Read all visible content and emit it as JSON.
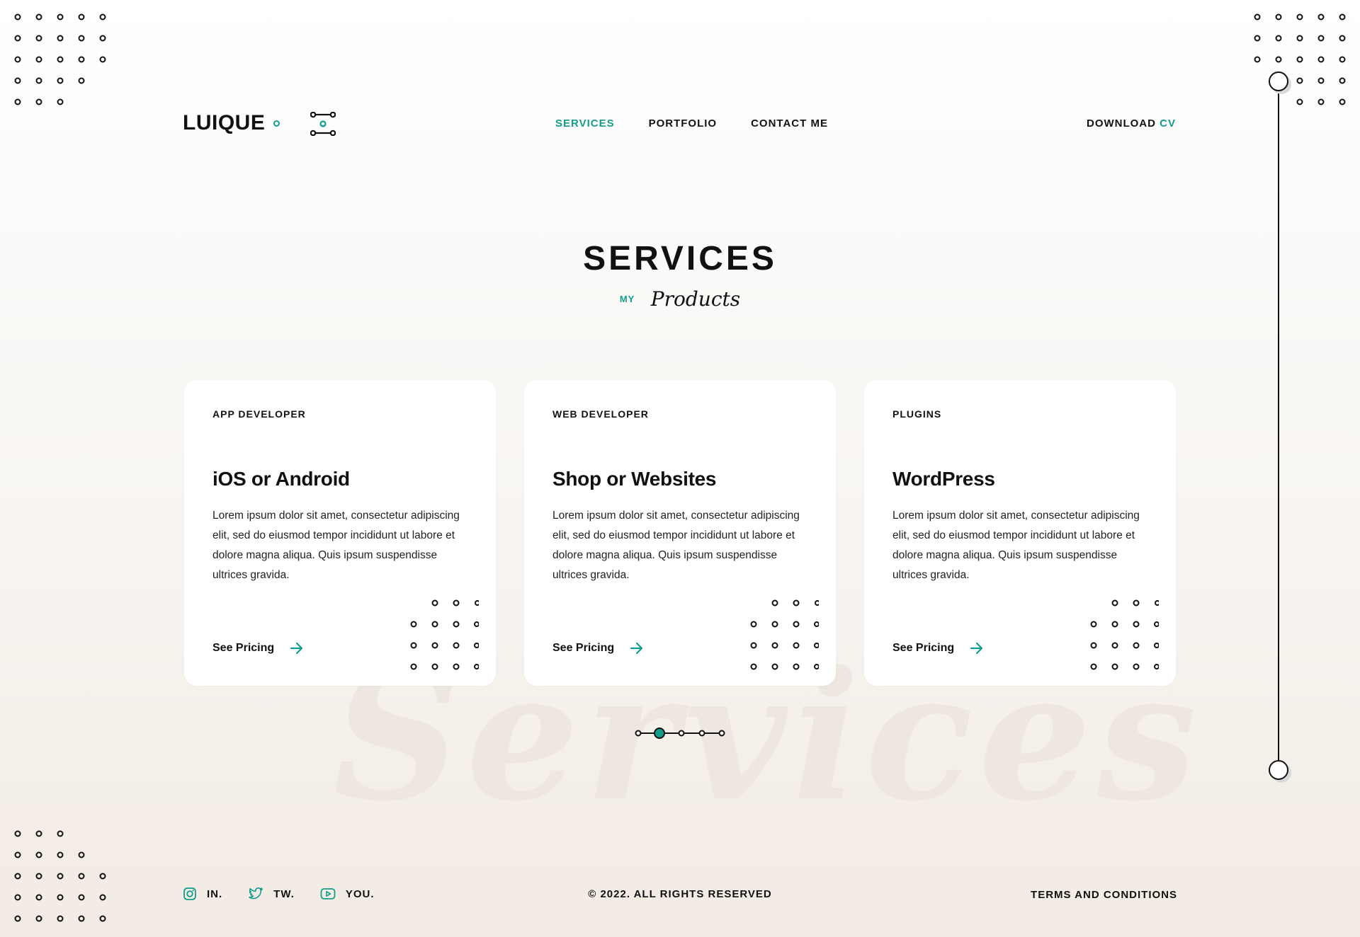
{
  "colors": {
    "accent": "#129c8c",
    "text": "#111111",
    "background": "#f7f3ee"
  },
  "header": {
    "logo": "LUIQUE",
    "menu_icon": "menu-toggle-icon",
    "nav": [
      {
        "label": "SERVICES",
        "active": true
      },
      {
        "label": "PORTFOLIO",
        "active": false
      },
      {
        "label": "CONTACT ME",
        "active": false
      }
    ],
    "download_label": "DOWNLOAD",
    "download_accent": "CV"
  },
  "hero": {
    "title": "SERVICES",
    "sub_prefix": "MY",
    "sub_script": "Products",
    "watermark": "Services"
  },
  "cards": [
    {
      "category": "APP DEVELOPER",
      "title": "iOS or Android",
      "description": "Lorem ipsum dolor sit amet, consectetur adipiscing elit, sed do eiusmod tempor incididunt ut labore et dolore magna aliqua. Quis ipsum suspendisse ultrices gravida.",
      "link": "See Pricing"
    },
    {
      "category": "WEB DEVELOPER",
      "title": "Shop or Websites",
      "description": "Lorem ipsum dolor sit amet, consectetur adipiscing elit, sed do eiusmod tempor incididunt ut labore et dolore magna aliqua. Quis ipsum suspendisse ultrices gravida.",
      "link": "See Pricing"
    },
    {
      "category": "PLUGINS",
      "title": "WordPress",
      "description": "Lorem ipsum dolor sit amet, consectetur adipiscing elit, sed do eiusmod tempor incididunt ut labore et dolore magna aliqua. Quis ipsum suspendisse ultrices gravida.",
      "link": "See Pricing"
    }
  ],
  "pager": {
    "total": 5,
    "current": 2
  },
  "footer": {
    "socials": [
      {
        "label": "IN.",
        "icon": "instagram-icon"
      },
      {
        "label": "TW.",
        "icon": "twitter-icon"
      },
      {
        "label": "YOU.",
        "icon": "youtube-icon"
      }
    ],
    "copyright": "© 2022. ALL RIGHTS RESERVED",
    "terms": "TERMS AND CONDITIONS"
  }
}
